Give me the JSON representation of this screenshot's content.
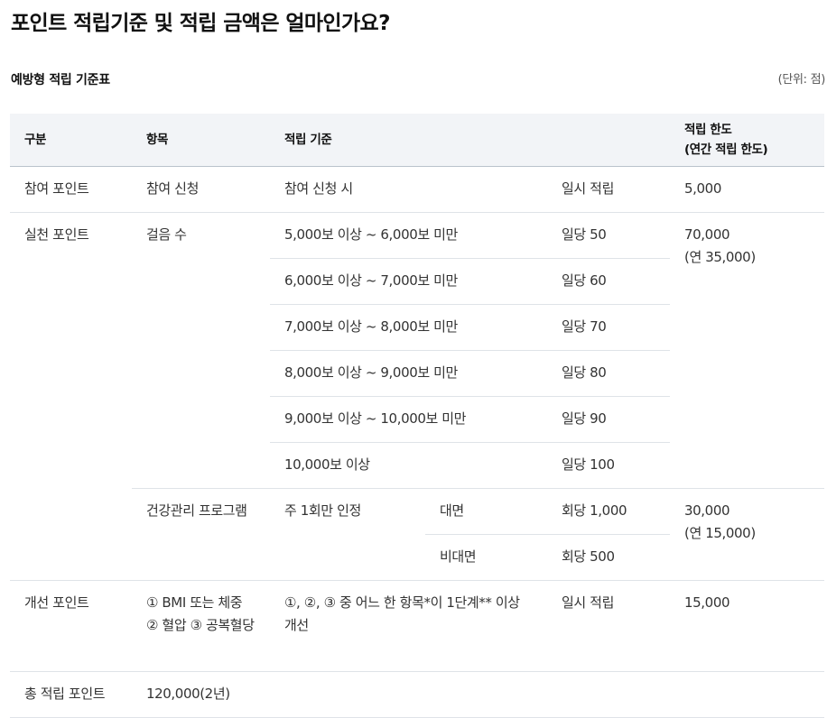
{
  "page": {
    "title": "포인트 적립기준 및 적립 금액은 얼마인가요?",
    "subtitle": "예방형 적립 기준표",
    "unit": "(단위: 점)"
  },
  "table": {
    "headers": {
      "category": "구분",
      "item": "항목",
      "criteria": "적립 기준",
      "limit_line1": "적립 한도",
      "limit_line2": "(연간 적립 한도)"
    },
    "participation": {
      "category": "참여 포인트",
      "item": "참여 신청",
      "criteria": "참여 신청 시",
      "amount": "일시 적립",
      "limit": "5,000"
    },
    "practice": {
      "category": "실천 포인트",
      "steps": {
        "item": "걸음 수",
        "limit_line1": "70,000",
        "limit_line2": "(연 35,000)",
        "rows": [
          {
            "criteria": "5,000보 이상 ~ 6,000보 미만",
            "amount": "일당 50"
          },
          {
            "criteria": "6,000보 이상 ~ 7,000보 미만",
            "amount": "일당 60"
          },
          {
            "criteria": "7,000보 이상 ~ 8,000보 미만",
            "amount": "일당 70"
          },
          {
            "criteria": "8,000보 이상 ~ 9,000보 미만",
            "amount": "일당 80"
          },
          {
            "criteria": "9,000보 이상 ~ 10,000보 미만",
            "amount": "일당 90"
          },
          {
            "criteria": "10,000보 이상",
            "amount": "일당 100"
          }
        ]
      },
      "program": {
        "item": "건강관리 프로그램",
        "criteria": "주 1회만 인정",
        "limit_line1": "30,000",
        "limit_line2": "(연 15,000)",
        "rows": [
          {
            "type": "대면",
            "amount": "회당 1,000"
          },
          {
            "type": "비대면",
            "amount": "회당 500"
          }
        ]
      }
    },
    "improvement": {
      "category": "개선 포인트",
      "item": "① BMI 또는 체중 ② 혈압 ③ 공복혈당",
      "criteria": "①, ②, ③ 중 어느 한 항목*이 1단계** 이상 개선",
      "amount": "일시 적립",
      "limit": "15,000"
    },
    "total": {
      "category": "총 적립 포인트",
      "value": "120,000(2년)"
    }
  }
}
